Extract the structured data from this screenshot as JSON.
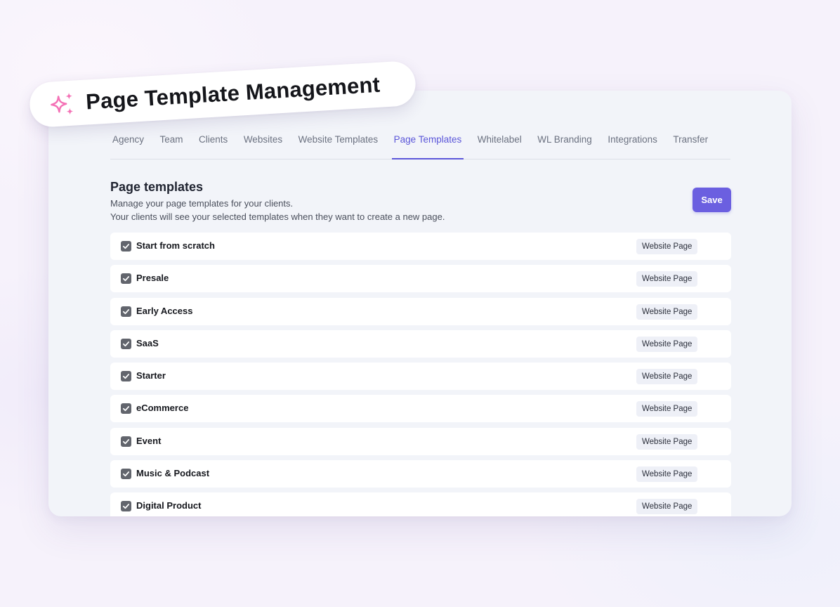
{
  "banner": {
    "title": "Page Template Management",
    "icon": "sparkles-icon",
    "icon_color": "#f472b6"
  },
  "tabs": [
    {
      "label": "Agency",
      "active": false
    },
    {
      "label": "Team",
      "active": false
    },
    {
      "label": "Clients",
      "active": false
    },
    {
      "label": "Websites",
      "active": false
    },
    {
      "label": "Website Templates",
      "active": false
    },
    {
      "label": "Page Templates",
      "active": true
    },
    {
      "label": "Whitelabel",
      "active": false
    },
    {
      "label": "WL Branding",
      "active": false
    },
    {
      "label": "Integrations",
      "active": false
    },
    {
      "label": "Transfer",
      "active": false
    }
  ],
  "section": {
    "title": "Page templates",
    "description_line1": "Manage your page templates for your clients.",
    "description_line2": "Your clients will see your selected templates when they want to create a new page.",
    "save_label": "Save"
  },
  "templates": [
    {
      "name": "Start from scratch",
      "type": "Website Page",
      "checked": true
    },
    {
      "name": "Presale",
      "type": "Website Page",
      "checked": true
    },
    {
      "name": "Early Access",
      "type": "Website Page",
      "checked": true
    },
    {
      "name": "SaaS",
      "type": "Website Page",
      "checked": true
    },
    {
      "name": "Starter",
      "type": "Website Page",
      "checked": true
    },
    {
      "name": "eCommerce",
      "type": "Website Page",
      "checked": true
    },
    {
      "name": "Event",
      "type": "Website Page",
      "checked": true
    },
    {
      "name": "Music & Podcast",
      "type": "Website Page",
      "checked": true
    },
    {
      "name": "Digital Product",
      "type": "Website Page",
      "checked": true
    }
  ],
  "colors": {
    "accent": "#5b56d9",
    "save_button": "#6b5fe0",
    "checkbox": "#62656d",
    "window_bg": "#f2f4f9"
  }
}
